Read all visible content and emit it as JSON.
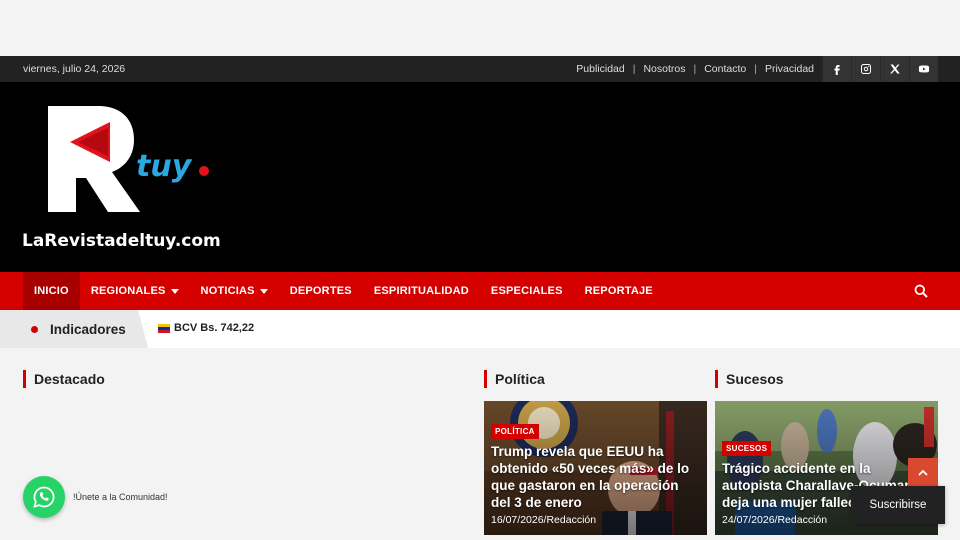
{
  "topbar": {
    "date": "viernes, julio 24, 2026",
    "links": [
      "Publicidad",
      "Nosotros",
      "Contacto",
      "Privacidad"
    ],
    "social_icons": [
      "facebook-icon",
      "instagram-icon",
      "x-icon",
      "youtube-icon"
    ]
  },
  "logo": {
    "letter": "R",
    "tuy": "tuy",
    "wordmark": "LaRevistadeltuy.com"
  },
  "nav": {
    "items": [
      {
        "label": "INICIO",
        "active": true
      },
      {
        "label": "REGIONALES",
        "dropdown": true
      },
      {
        "label": "NOTICIAS",
        "dropdown": true
      },
      {
        "label": "DEPORTES"
      },
      {
        "label": "ESPIRITUALIDAD"
      },
      {
        "label": "ESPECIALES"
      },
      {
        "label": "REPORTAJE"
      }
    ]
  },
  "ticker": {
    "label": "Indicadores",
    "item": "BCV Bs. 742,22"
  },
  "sections": {
    "destacado": "Destacado",
    "politica": "Política",
    "sucesos": "Sucesos"
  },
  "cards": [
    {
      "category": "POLÍTICA",
      "title": "Trump revela que EEUU ha obtenido «50 veces más» de lo que gastaron en la operación del 3 de enero",
      "date": "16/07/2026",
      "author": "Redacción",
      "meta": "16/07/2026/Redacción"
    },
    {
      "category": "SUCESOS",
      "title": "Trágico accidente en la autopista Charallave-Ocumare deja una mujer fallecida",
      "date": "24/07/2026",
      "author": "Redacción",
      "meta": "24/07/2026/Redacción"
    }
  ],
  "whatsapp": {
    "label": "!Únete a la Comunidad!"
  },
  "subscribe": {
    "label": "Suscribirse"
  },
  "colors": {
    "accent": "#d40000",
    "topbar": "#222222",
    "header": "#000000",
    "whatsapp": "#25d366",
    "logo_blue": "#2aa9e0"
  }
}
